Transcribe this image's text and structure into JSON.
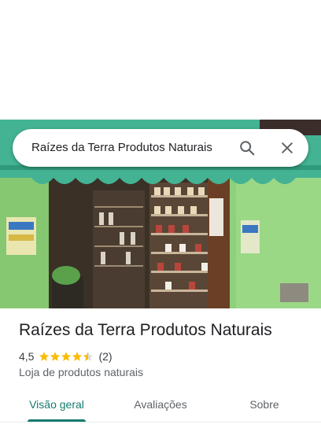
{
  "search": {
    "query": "Raízes da Terra Produtos Naturais",
    "search_icon": "search-icon",
    "close_icon": "close-icon"
  },
  "place": {
    "name": "Raízes da Terra Produtos Naturais",
    "rating": "4,5",
    "rating_value": 4.5,
    "review_count": "(2)",
    "category": "Loja de produtos naturais",
    "star_color": "#fbbc04"
  },
  "tabs": [
    {
      "label": "Visão geral",
      "active": true
    },
    {
      "label": "Avaliações",
      "active": false
    },
    {
      "label": "Sobre",
      "active": false
    }
  ],
  "colors": {
    "accent": "#137a6e",
    "awning": "#3fae8c",
    "wall": "#8fcf7a"
  }
}
